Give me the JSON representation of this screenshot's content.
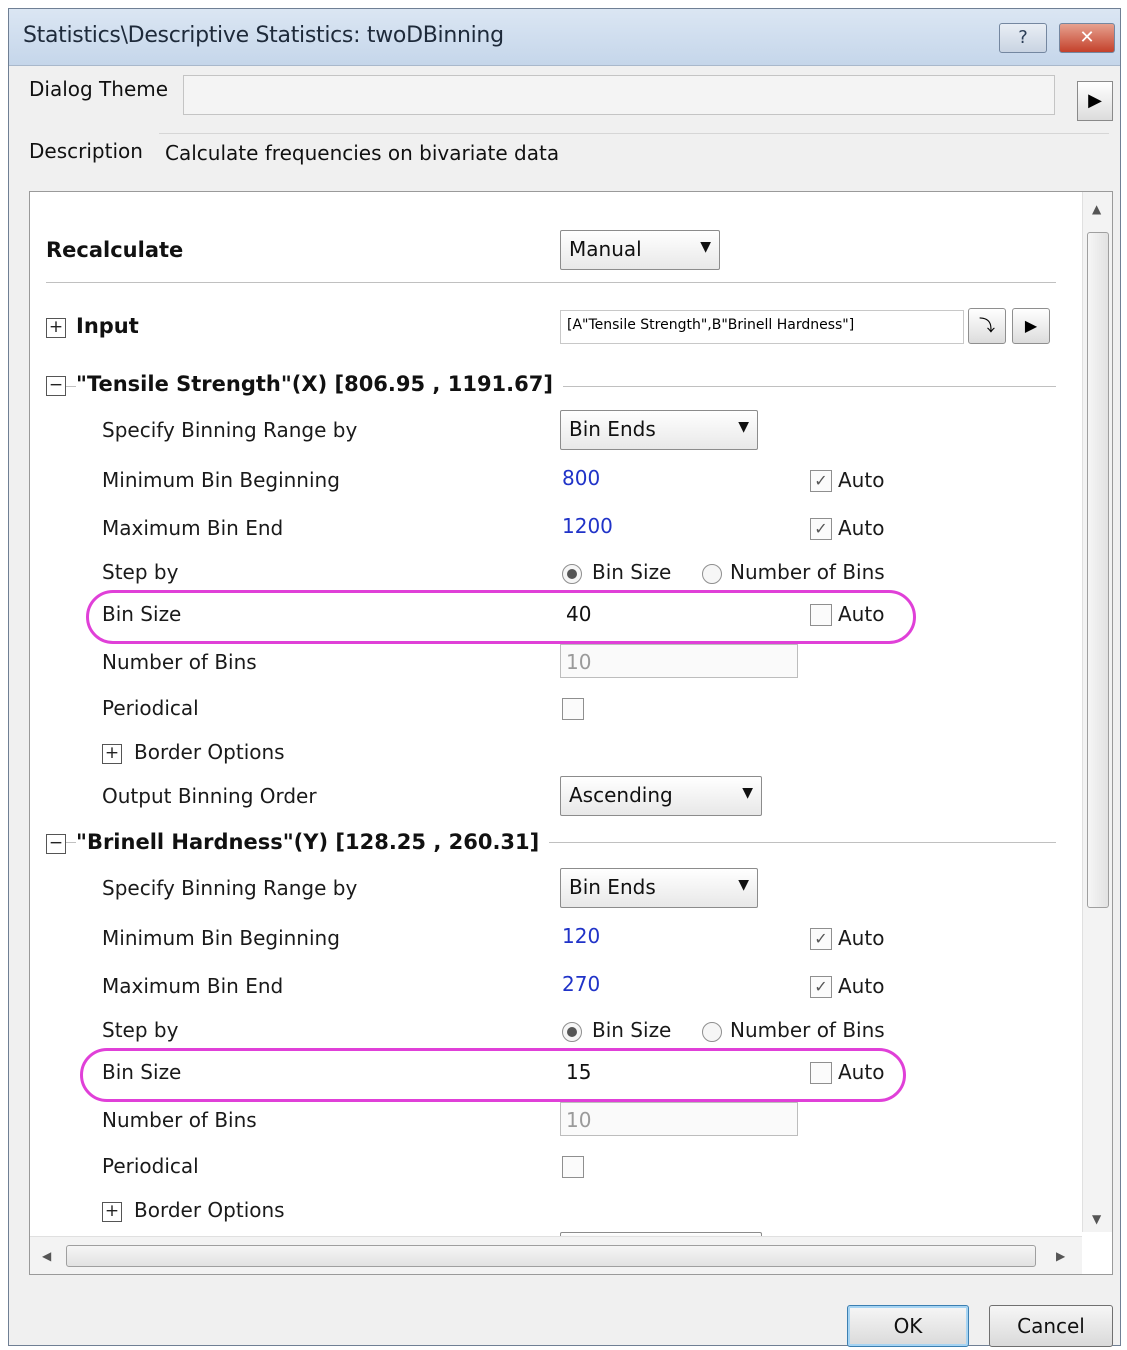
{
  "window": {
    "title": "Statistics\\Descriptive Statistics: twoDBinning",
    "help_label": "?",
    "close_label": "✕"
  },
  "dialog_theme": {
    "label": "Dialog Theme",
    "value": ""
  },
  "description": {
    "label": "Description",
    "value": "Calculate frequencies on bivariate data"
  },
  "recalculate": {
    "label": "Recalculate",
    "value": "Manual"
  },
  "input": {
    "label": "Input",
    "value": "[A\"Tensile Strength\",B\"Brinell Hardness\"]"
  },
  "x_section": {
    "title": "\"Tensile Strength\"(X) [806.95 , 1191.67]",
    "specify_label": "Specify Binning Range by",
    "specify_value": "Bin Ends",
    "min_label": "Minimum Bin Beginning",
    "min_value": "800",
    "min_auto": "Auto",
    "max_label": "Maximum Bin End",
    "max_value": "1200",
    "max_auto": "Auto",
    "step_label": "Step by",
    "step_opt1": "Bin Size",
    "step_opt2": "Number of Bins",
    "binsize_label": "Bin Size",
    "binsize_value": "40",
    "binsize_auto": "Auto",
    "nbins_label": "Number of Bins",
    "nbins_value": "10",
    "periodical_label": "Periodical",
    "border_label": "Border Options",
    "order_label": "Output Binning Order",
    "order_value": "Ascending"
  },
  "y_section": {
    "title": "\"Brinell Hardness\"(Y) [128.25 , 260.31]",
    "specify_label": "Specify Binning Range by",
    "specify_value": "Bin Ends",
    "min_label": "Minimum Bin Beginning",
    "min_value": "120",
    "min_auto": "Auto",
    "max_label": "Maximum Bin End",
    "max_value": "270",
    "max_auto": "Auto",
    "step_label": "Step by",
    "step_opt1": "Bin Size",
    "step_opt2": "Number of Bins",
    "binsize_label": "Bin Size",
    "binsize_value": "15",
    "binsize_auto": "Auto",
    "nbins_label": "Number of Bins",
    "nbins_value": "10",
    "periodical_label": "Periodical",
    "border_label": "Border Options"
  },
  "buttons": {
    "ok": "OK",
    "cancel": "Cancel"
  },
  "colors": {
    "highlight": "#e040d8",
    "value_blue": "#2033c8"
  }
}
